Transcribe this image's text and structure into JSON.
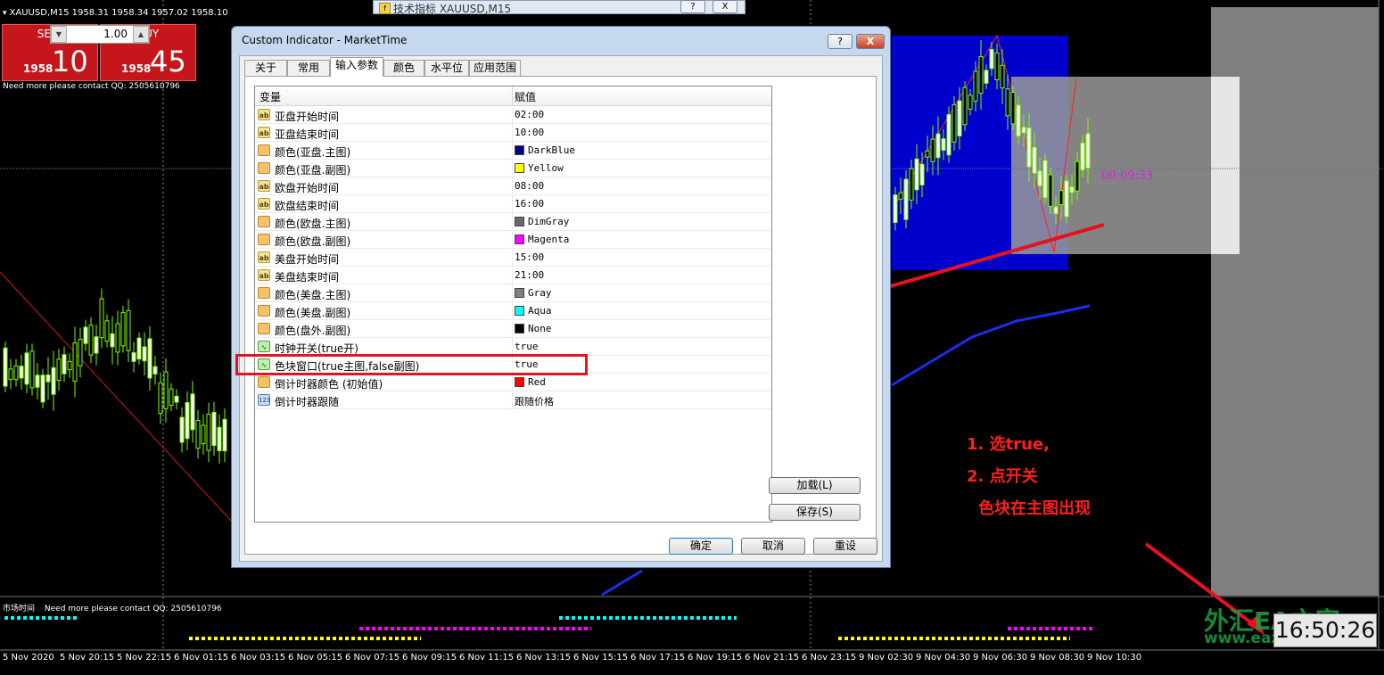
{
  "chart": {
    "title": "XAUUSD,M15  1958.31 1958.34 1957.02 1958.10",
    "info_note": "Need more please contact QQ: 2505610796",
    "sub_window_label": "市场时间",
    "sub_window_note": "Need more please contact QQ: 2505610796",
    "countdown": "00:09:33",
    "clock": "16:50:26",
    "time_axis": [
      "5 Nov 2020",
      "5 Nov 20:15",
      "5 Nov 22:15",
      "6 Nov 01:15",
      "6 Nov 03:15",
      "6 Nov 05:15",
      "6 Nov 07:15",
      "6 Nov 09:15",
      "6 Nov 11:15",
      "6 Nov 13:15",
      "6 Nov 15:15",
      "6 Nov 17:15",
      "6 Nov 19:15",
      "6 Nov 21:15",
      "6 Nov 23:15",
      "9 Nov 02:30",
      "9 Nov 04:30",
      "9 Nov 06:30",
      "9 Nov 08:30",
      "9 Nov 10:30"
    ],
    "watermark": "外汇EA之家",
    "watermark_url": "www.eazhijia.com"
  },
  "trade_panel": {
    "sell_label": "SELL",
    "buy_label": "BUY",
    "lot_value": "1.00",
    "sell_price_small": "1958",
    "sell_price_big": "10",
    "buy_price_small": "1958",
    "buy_price_big": "45"
  },
  "background_window": {
    "title": "技术指标 XAUUSD,M15",
    "help": "?",
    "close": "X"
  },
  "dialog": {
    "title": "Custom Indicator - MarketTime",
    "help_btn": "?",
    "close_btn": "X",
    "tabs": [
      "关于",
      "常用",
      "输入参数",
      "颜色",
      "水平位",
      "应用范围"
    ],
    "active_tab": 2,
    "columns": {
      "name": "变量",
      "value": "赋值"
    },
    "params": [
      {
        "icon": "ab",
        "name": "亚盘开始时间",
        "value": "02:00"
      },
      {
        "icon": "ab",
        "name": "亚盘结束时间",
        "value": "10:00"
      },
      {
        "icon": "clr",
        "name": "颜色(亚盘.主图)",
        "value": "DarkBlue",
        "color": "#00008b"
      },
      {
        "icon": "clr",
        "name": "颜色(亚盘.副图)",
        "value": "Yellow",
        "color": "#ffff00"
      },
      {
        "icon": "ab",
        "name": "欧盘开始时间",
        "value": "08:00"
      },
      {
        "icon": "ab",
        "name": "欧盘结束时间",
        "value": "16:00"
      },
      {
        "icon": "clr",
        "name": "颜色(欧盘.主图)",
        "value": "DimGray",
        "color": "#696969"
      },
      {
        "icon": "clr",
        "name": "颜色(欧盘.副图)",
        "value": "Magenta",
        "color": "#ff00ff"
      },
      {
        "icon": "ab",
        "name": "美盘开始时间",
        "value": "15:00"
      },
      {
        "icon": "ab",
        "name": "美盘结束时间",
        "value": "21:00"
      },
      {
        "icon": "clr",
        "name": "颜色(美盘.主图)",
        "value": "Gray",
        "color": "#808080"
      },
      {
        "icon": "clr",
        "name": "颜色(美盘.副图)",
        "value": "Aqua",
        "color": "#00ffff"
      },
      {
        "icon": "clr",
        "name": "颜色(盘外.副图)",
        "value": "None",
        "color": "#000000"
      },
      {
        "icon": "bool",
        "name": "时钟开关(true开)",
        "value": "true"
      },
      {
        "icon": "bool",
        "name": "色块窗口(true主图,false副图)",
        "value": "true"
      },
      {
        "icon": "clr",
        "name": "倒计时器颜色 (初始值)",
        "value": "Red",
        "color": "#ff0000"
      },
      {
        "icon": "num",
        "name": "倒计时器跟随",
        "value": "跟随价格"
      }
    ],
    "load_btn": "加载(L)",
    "save_btn": "保存(S)",
    "ok_btn": "确定",
    "cancel_btn": "取消",
    "reset_btn": "重设"
  },
  "annotations": {
    "step1": "1. 选true,",
    "step2": "2. 点开关",
    "step3": "色块在主图出现"
  },
  "colors": {
    "sell_buy": "#c5161b",
    "asia_block": "#0000cd",
    "annotation": "#ff1f1f",
    "candles": "#7cfc00"
  }
}
